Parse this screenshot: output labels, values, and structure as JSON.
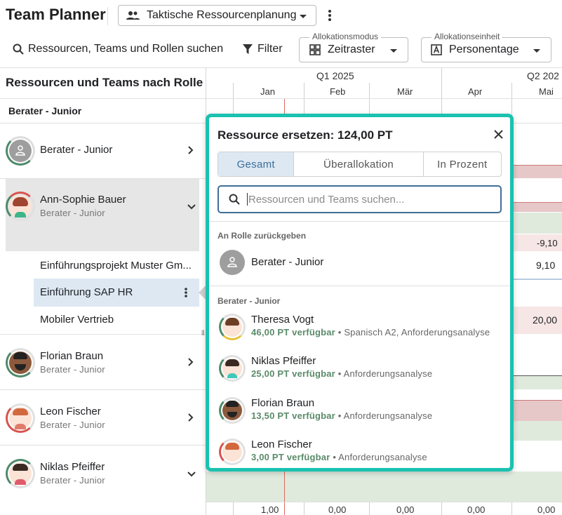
{
  "header": {
    "title": "Team Planner",
    "view_select": "Taktische Ressourcenplanung"
  },
  "toolbar": {
    "search_label": "Ressourcen, Teams und Rollen suchen",
    "filter_label": "Filter",
    "allocation_mode": {
      "label": "Allokationsmodus",
      "value": "Zeitraster"
    },
    "allocation_unit": {
      "label": "Allokationseinheit",
      "value": "Personentage"
    }
  },
  "left_panel": {
    "heading": "Ressourcen und Teams nach Rolle",
    "group": "Berater - Junior",
    "rows": [
      {
        "name": "Berater - Junior",
        "role": ""
      },
      {
        "name": "Ann-Sophie Bauer",
        "role": "Berater - Junior"
      },
      {
        "name": "Florian Braun",
        "role": "Berater - Junior"
      },
      {
        "name": "Leon Fischer",
        "role": "Berater - Junior"
      },
      {
        "name": "Niklas Pfeiffer",
        "role": "Berater - Junior"
      }
    ],
    "projects": [
      "Einführungsprojekt Muster Gm...",
      "Einführung SAP HR",
      "Mobiler Vertrieb"
    ]
  },
  "timeline": {
    "quarters": [
      "Q1 2025",
      "Q2 202"
    ],
    "months": [
      "Jan",
      "Feb",
      "Mär",
      "Apr",
      "Mai"
    ],
    "cells": [
      "-9,10",
      "9,10",
      "20,00"
    ],
    "footer": [
      "1,00",
      "0,00",
      "0,00",
      "0,00",
      "0,00"
    ]
  },
  "popup": {
    "title": "Ressource ersetzen: 124,00 PT",
    "tabs": [
      "Gesamt",
      "Überallokation",
      "In Prozent"
    ],
    "search_placeholder": "Ressourcen und Teams suchen...",
    "return_section": "An Rolle zurückgeben",
    "return_item": "Berater - Junior",
    "candidates_section": "Berater - Junior",
    "candidates": [
      {
        "name": "Theresa Vogt",
        "avail": "46,00 PT verfügbar",
        "skills": "• Spanisch A2, Anforderungsanalyse"
      },
      {
        "name": "Niklas Pfeiffer",
        "avail": "25,00 PT verfügbar",
        "skills": "• Anforderungsanalyse"
      },
      {
        "name": "Florian Braun",
        "avail": "13,50 PT verfügbar",
        "skills": "• Anforderungsanalyse"
      },
      {
        "name": "Leon Fischer",
        "avail": "3,00 PT verfügbar",
        "skills": "• Anforderungsanalyse"
      }
    ]
  },
  "colors": {
    "accent_teal": "#19c2b0",
    "primary_blue": "#3f6e99",
    "available_green": "#5a8a6a",
    "overallocation_red": "#e7c8c8",
    "allocation_green": "#dfeadd"
  }
}
